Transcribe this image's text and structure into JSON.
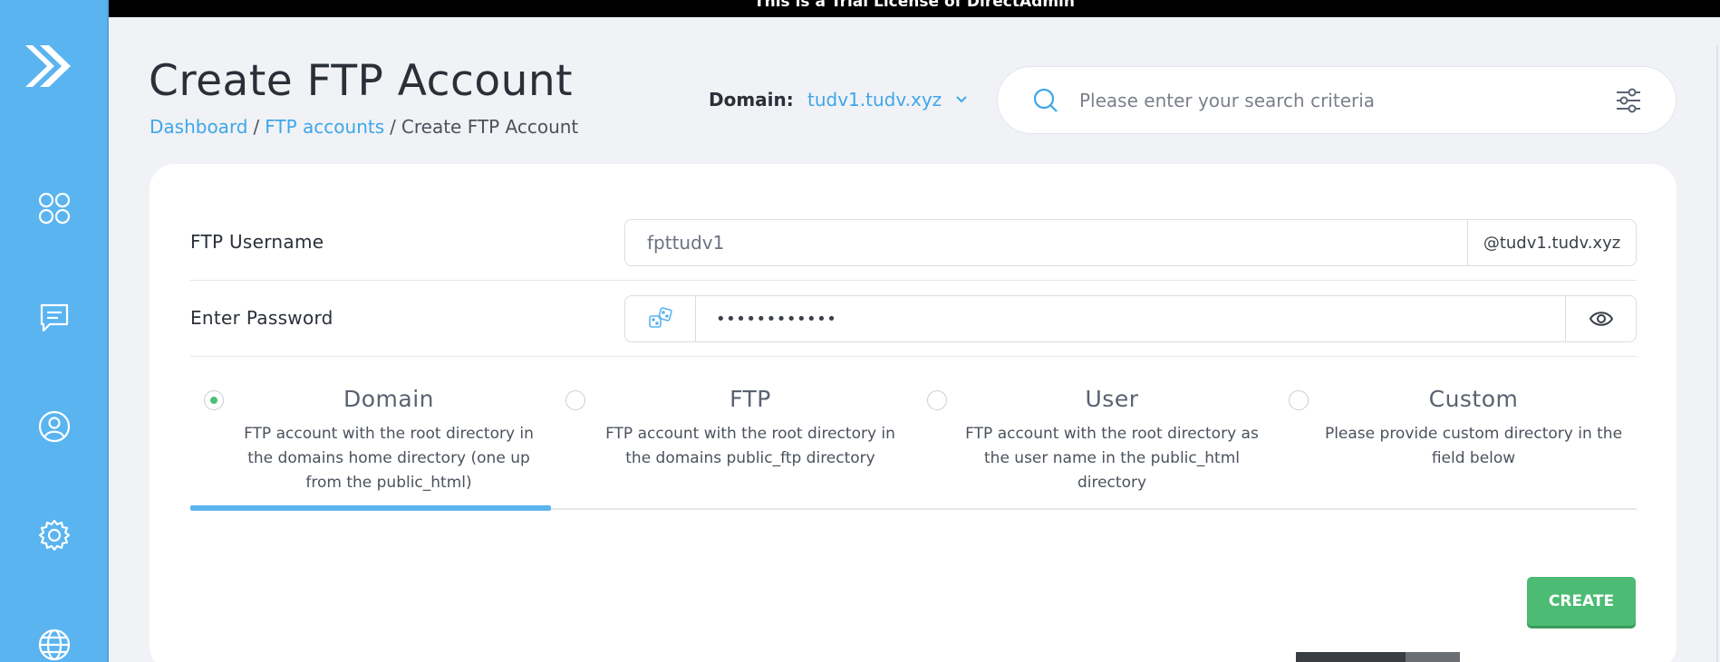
{
  "banner": {
    "text": "This is a Trial License of DirectAdmin"
  },
  "sidebar": {
    "items": [
      {
        "icon": "apps-icon"
      },
      {
        "icon": "chat-icon"
      },
      {
        "icon": "user-icon"
      },
      {
        "icon": "gear-icon"
      },
      {
        "icon": "globe-icon"
      }
    ]
  },
  "header": {
    "title": "Create FTP Account",
    "breadcrumb": [
      "Dashboard",
      "FTP accounts",
      "Create FTP Account"
    ],
    "breadcrumb_sep": "/",
    "domain_label": "Domain:",
    "domain_value": "tudv1.tudv.xyz"
  },
  "search": {
    "placeholder": "Please enter your search criteria"
  },
  "form": {
    "username_label": "FTP Username",
    "username_value": "fpttudv1",
    "username_suffix": "@tudv1.tudv.xyz",
    "password_label": "Enter Password",
    "password_value": "••••••••••••",
    "options": [
      {
        "title": "Domain",
        "desc": "FTP account with the root directory in the domains home directory (one up from the public_html)",
        "selected": true
      },
      {
        "title": "FTP",
        "desc": "FTP account with the root directory in the domains public_ftp directory",
        "selected": false
      },
      {
        "title": "User",
        "desc": "FTP account with the root directory as the user name in the public_html directory",
        "selected": false
      },
      {
        "title": "Custom",
        "desc": "Please provide custom directory in the field below",
        "selected": false
      }
    ],
    "create_label": "CREATE"
  },
  "colors": {
    "accent": "#5ab4f0",
    "link": "#3fa6e8",
    "success": "#4cbb74"
  }
}
